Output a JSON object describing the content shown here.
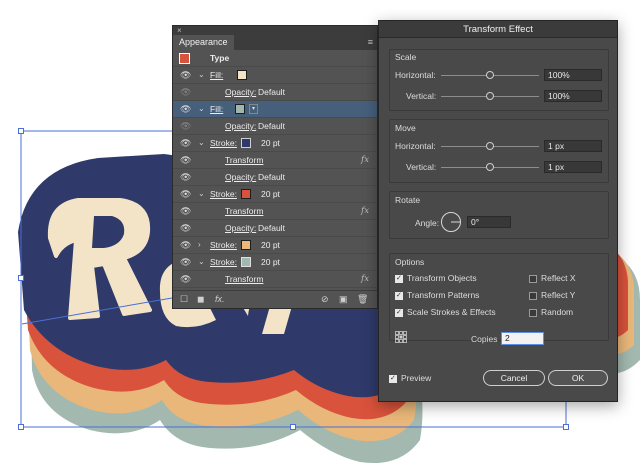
{
  "appearance_panel": {
    "tab_label": "Appearance",
    "close_icon": "×",
    "rows": [
      {
        "kind": "header",
        "label": "Type"
      },
      {
        "kind": "fill",
        "label": "Fill:",
        "swatch": "#f3e4c8"
      },
      {
        "kind": "sub",
        "label": "Opacity:",
        "value": "Default"
      },
      {
        "kind": "fill-selected",
        "label": "Fill:",
        "swatch": "#9fb5ad"
      },
      {
        "kind": "sub",
        "label": "Opacity:",
        "value": "Default"
      },
      {
        "kind": "stroke",
        "label": "Stroke:",
        "swatch": "#2f3a6b",
        "value": "20 pt"
      },
      {
        "kind": "transform",
        "label": "Transform"
      },
      {
        "kind": "sub",
        "label": "Opacity:",
        "value": "Default"
      },
      {
        "kind": "stroke",
        "label": "Stroke:",
        "swatch": "#d9523b",
        "value": "20 pt"
      },
      {
        "kind": "transform",
        "label": "Transform"
      },
      {
        "kind": "sub",
        "label": "Opacity:",
        "value": "Default"
      },
      {
        "kind": "stroke-collapsed",
        "label": "Stroke:",
        "swatch": "#e9b77a",
        "value": "20 pt"
      },
      {
        "kind": "stroke",
        "label": "Stroke:",
        "swatch": "#a3b9b0",
        "value": "20 pt"
      },
      {
        "kind": "transform",
        "label": "Transform"
      }
    ]
  },
  "dialog": {
    "title": "Transform Effect",
    "scale": {
      "title": "Scale",
      "horizontal_label": "Horizontal:",
      "horizontal_value": "100%",
      "vertical_label": "Vertical:",
      "vertical_value": "100%"
    },
    "move": {
      "title": "Move",
      "horizontal_label": "Horizontal:",
      "horizontal_value": "1 px",
      "vertical_label": "Vertical:",
      "vertical_value": "1 px"
    },
    "rotate": {
      "title": "Rotate",
      "angle_label": "Angle:",
      "angle_value": "0°"
    },
    "options": {
      "title": "Options",
      "transform_objects": {
        "label": "Transform Objects",
        "checked": true
      },
      "transform_patterns": {
        "label": "Transform Patterns",
        "checked": true
      },
      "scale_strokes": {
        "label": "Scale Strokes & Effects",
        "checked": true
      },
      "reflect_x": {
        "label": "Reflect X",
        "checked": false
      },
      "reflect_y": {
        "label": "Reflect Y",
        "checked": false
      },
      "random": {
        "label": "Random",
        "checked": false
      }
    },
    "copies_label": "Copies",
    "copies_value": "2",
    "preview": {
      "label": "Preview",
      "checked": true
    },
    "cancel_label": "Cancel",
    "ok_label": "OK"
  },
  "artwork": {
    "colors": {
      "fill": "#f3e4c8",
      "navy": "#2f3a6b",
      "red": "#d9523b",
      "peach": "#e9b77a",
      "sage": "#a3b9b0"
    }
  }
}
